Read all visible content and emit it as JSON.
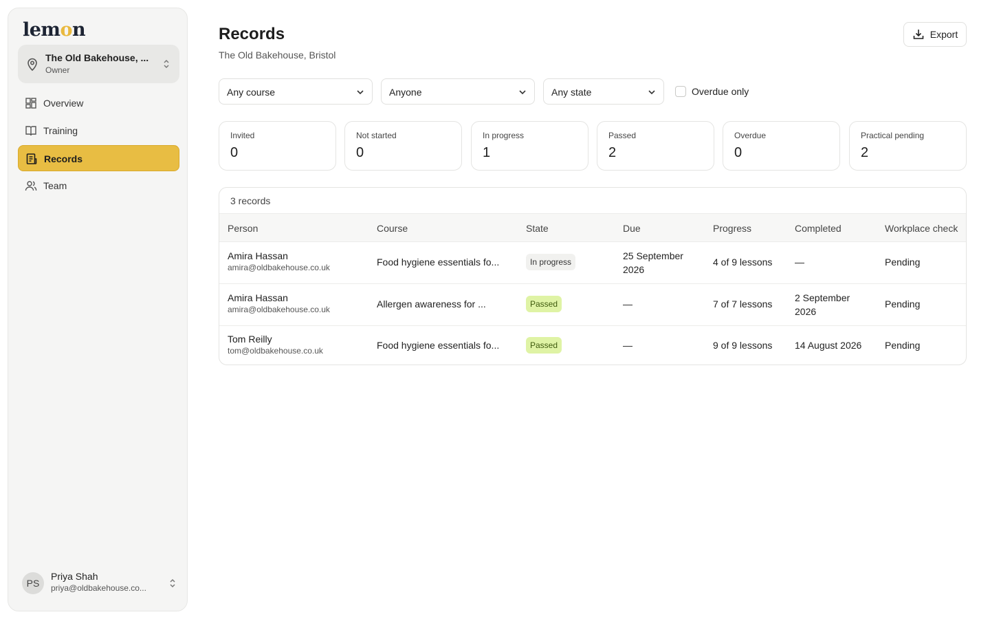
{
  "sidebar": {
    "logo": {
      "pre": "lem",
      "accent": "o",
      "post": "n"
    },
    "org": {
      "name": "The Old Bakehouse, ...",
      "role": "Owner"
    },
    "nav": [
      {
        "label": "Overview",
        "icon": "dashboard-icon"
      },
      {
        "label": "Training",
        "icon": "book-icon"
      },
      {
        "label": "Records",
        "icon": "records-icon",
        "active": true
      },
      {
        "label": "Team",
        "icon": "users-icon"
      }
    ],
    "user": {
      "initials": "PS",
      "name": "Priya Shah",
      "email": "priya@oldbakehouse.co..."
    }
  },
  "header": {
    "title": "Records",
    "subtitle": "The Old Bakehouse, Bristol",
    "export_label": "Export"
  },
  "filters": {
    "course": "Any course",
    "person": "Anyone",
    "state": "Any state",
    "overdue_label": "Overdue only",
    "overdue_checked": false
  },
  "stats": [
    {
      "label": "Invited",
      "value": "0"
    },
    {
      "label": "Not started",
      "value": "0"
    },
    {
      "label": "In progress",
      "value": "1"
    },
    {
      "label": "Passed",
      "value": "2"
    },
    {
      "label": "Overdue",
      "value": "0"
    },
    {
      "label": "Practical pending",
      "value": "2"
    }
  ],
  "table": {
    "count_label": "3 records",
    "columns": [
      "Person",
      "Course",
      "State",
      "Due",
      "Progress",
      "Completed",
      "Workplace check"
    ],
    "rows": [
      {
        "name": "Amira Hassan",
        "email": "amira@oldbakehouse.co.uk",
        "course": "Food hygiene essentials fo...",
        "state": "In progress",
        "due_1": "25 September",
        "due_2": "2026",
        "progress": "4 of 9 lessons",
        "completed_1": "—",
        "completed_2": "",
        "check": "Pending"
      },
      {
        "name": "Amira Hassan",
        "email": "amira@oldbakehouse.co.uk",
        "course": "Allergen awareness for ...",
        "state": "Passed",
        "due_1": "—",
        "due_2": "",
        "progress": "7 of 7 lessons",
        "completed_1": "2 September",
        "completed_2": "2026",
        "check": "Pending"
      },
      {
        "name": "Tom Reilly",
        "email": "tom@oldbakehouse.co.uk",
        "course": "Food hygiene essentials fo...",
        "state": "Passed",
        "due_1": "—",
        "due_2": "",
        "progress": "9 of 9 lessons",
        "completed_1": "14 August 2026",
        "completed_2": "",
        "check": "Pending"
      }
    ]
  },
  "colors": {
    "accent": "#e8bd43",
    "passed_badge": "#dff3a5"
  }
}
